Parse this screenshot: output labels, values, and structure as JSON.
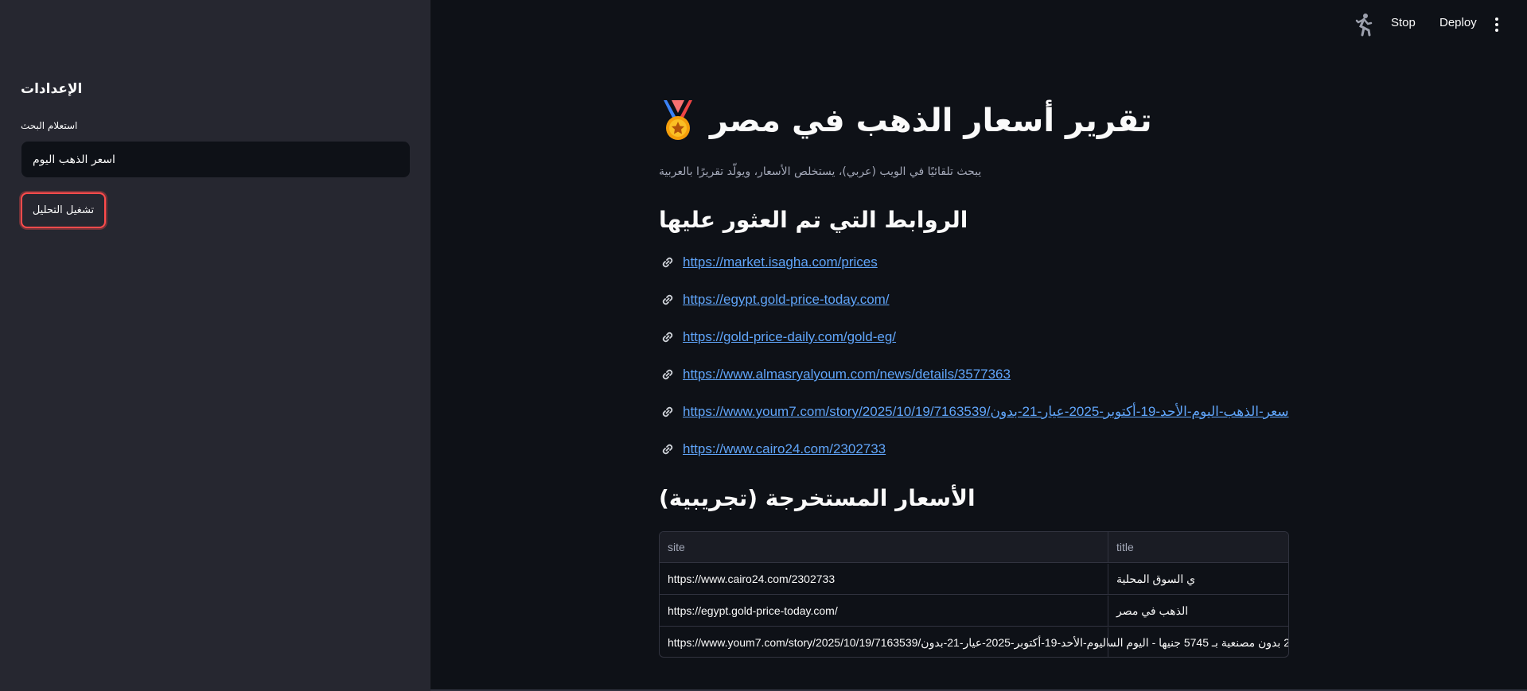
{
  "sidebar": {
    "title": "الإعدادات",
    "search_label": "استعلام البحث",
    "search_value": "اسعر الذهب اليوم",
    "run_button_label": "تشغيل التحليل"
  },
  "header": {
    "stop_label": "Stop",
    "deploy_label": "Deploy"
  },
  "main": {
    "title": "تقرير أسعار الذهب في مصر",
    "caption": "يبحث تلقائيًا في الويب (عربي)، يستخلص الأسعار، ويولّد تقريرًا بالعربية",
    "links_heading": "الروابط التي تم العثور عليها",
    "links": [
      "https://market.isagha.com/prices",
      "https://egypt.gold-price-today.com/",
      "https://gold-price-daily.com/gold-eg/",
      "https://www.almasryalyoum.com/news/details/3577363",
      "https://www.youm7.com/story/2025/10/19/7163539/سعر-الذهب-اليوم-الأحد-19-أكتوبر-2025-عيار-21-بدون",
      "https://www.cairo24.com/2302733"
    ],
    "prices_heading": "الأسعار المستخرجة (تجريبية)",
    "table": {
      "headers": [
        "site",
        "title"
      ],
      "rows": [
        [
          "https://www.cairo24.com/2302733",
          "ي السوق المحلية"
        ],
        [
          "https://egypt.gold-price-today.com/",
          "الذهب في مصر"
        ],
        [
          "https://www.youm7.com/story/2025/10/19/7163539/سعر-الذهب-اليوم-الأحد-19-أكتوبر-2025-عيار-21-بدون",
          "2 بدون مصنعية بـ 5745 جنيها - اليوم السابع"
        ]
      ]
    }
  },
  "colors": {
    "background": "#0e1117",
    "sidebar": "#262730",
    "accent": "#ff4b4b",
    "link": "#60a5fa"
  },
  "icons": {
    "status": "running-man-icon",
    "title": "medal-icon",
    "link": "link-icon",
    "menu": "kebab-menu-icon"
  }
}
